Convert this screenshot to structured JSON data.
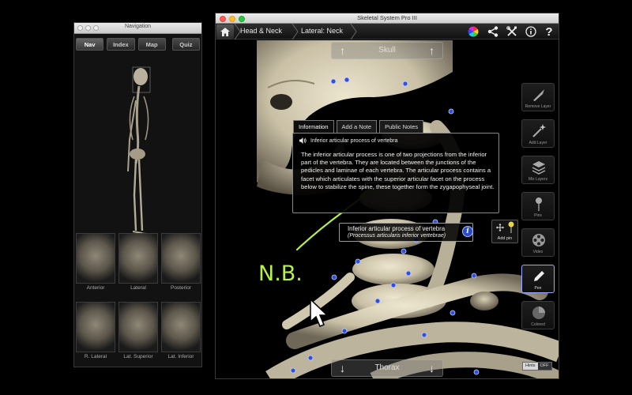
{
  "navigation_window": {
    "title": "Navigation",
    "tabs": [
      {
        "label": "Nav",
        "active": true
      },
      {
        "label": "Index",
        "active": false
      },
      {
        "label": "Map",
        "active": false
      },
      {
        "label": "Quiz",
        "active": false
      }
    ],
    "thumbnails": [
      {
        "label": "Anterior"
      },
      {
        "label": "Lateral"
      },
      {
        "label": "Posterior"
      },
      {
        "label": "R. Lateral"
      },
      {
        "label": "Lat. Superior"
      },
      {
        "label": "Lat. Inferior"
      }
    ]
  },
  "main_window": {
    "title": "Skeletal System Pro III",
    "breadcrumbs": [
      "Head & Neck",
      "Lateral: Neck"
    ],
    "toolbar_icons": [
      "color-wheel-icon",
      "share-icon",
      "tools-icon",
      "info-icon",
      "help-icon"
    ],
    "help_label": "?",
    "pan_top_label": "Skull",
    "pan_bottom_label": "Thorax",
    "popup": {
      "tabs": [
        {
          "label": "Information",
          "active": true
        },
        {
          "label": "Add a Note",
          "active": false
        },
        {
          "label": "Public Notes",
          "active": false
        }
      ],
      "heading": "Inferior articular process of vertebra",
      "body": "The inferior articular process is one of two projections from the inferior part of the vertebra. They are located between the junctions of the pedicles and laminae of each vertebra. The articular process contains a facet which articulates with the superior articular facet on the process below to stabilize the spine, these together form the zygapophyseal joint."
    },
    "label_box": {
      "name": "Inferior articular process of vertebra",
      "latin": "(Processus articularis inferior vertebrae)"
    },
    "add_pin_label": "Add pin",
    "annotation_text": "N.B.",
    "right_tools": [
      {
        "label": "Remove Layer",
        "icon": "scalpel-icon",
        "active": false
      },
      {
        "label": "Add Layer",
        "icon": "wand-icon",
        "active": false
      },
      {
        "label": "Mix Layers",
        "icon": "layers-icon",
        "active": false
      },
      {
        "label": "Pins",
        "icon": "pin-icon",
        "active": false
      },
      {
        "label": "Video",
        "icon": "film-reel-icon",
        "active": false
      },
      {
        "label": "Pen",
        "icon": "pen-icon",
        "active": true
      },
      {
        "label": "Colored",
        "icon": "colored-icon",
        "active": false
      }
    ],
    "hints": {
      "label": "Hints",
      "state": "OFF"
    }
  },
  "colors": {
    "annotation": "#b5f04e",
    "pin_blue": "#2f4fe0",
    "bone": "#d9d2bc",
    "active_tool_border": "#9da8ff"
  }
}
